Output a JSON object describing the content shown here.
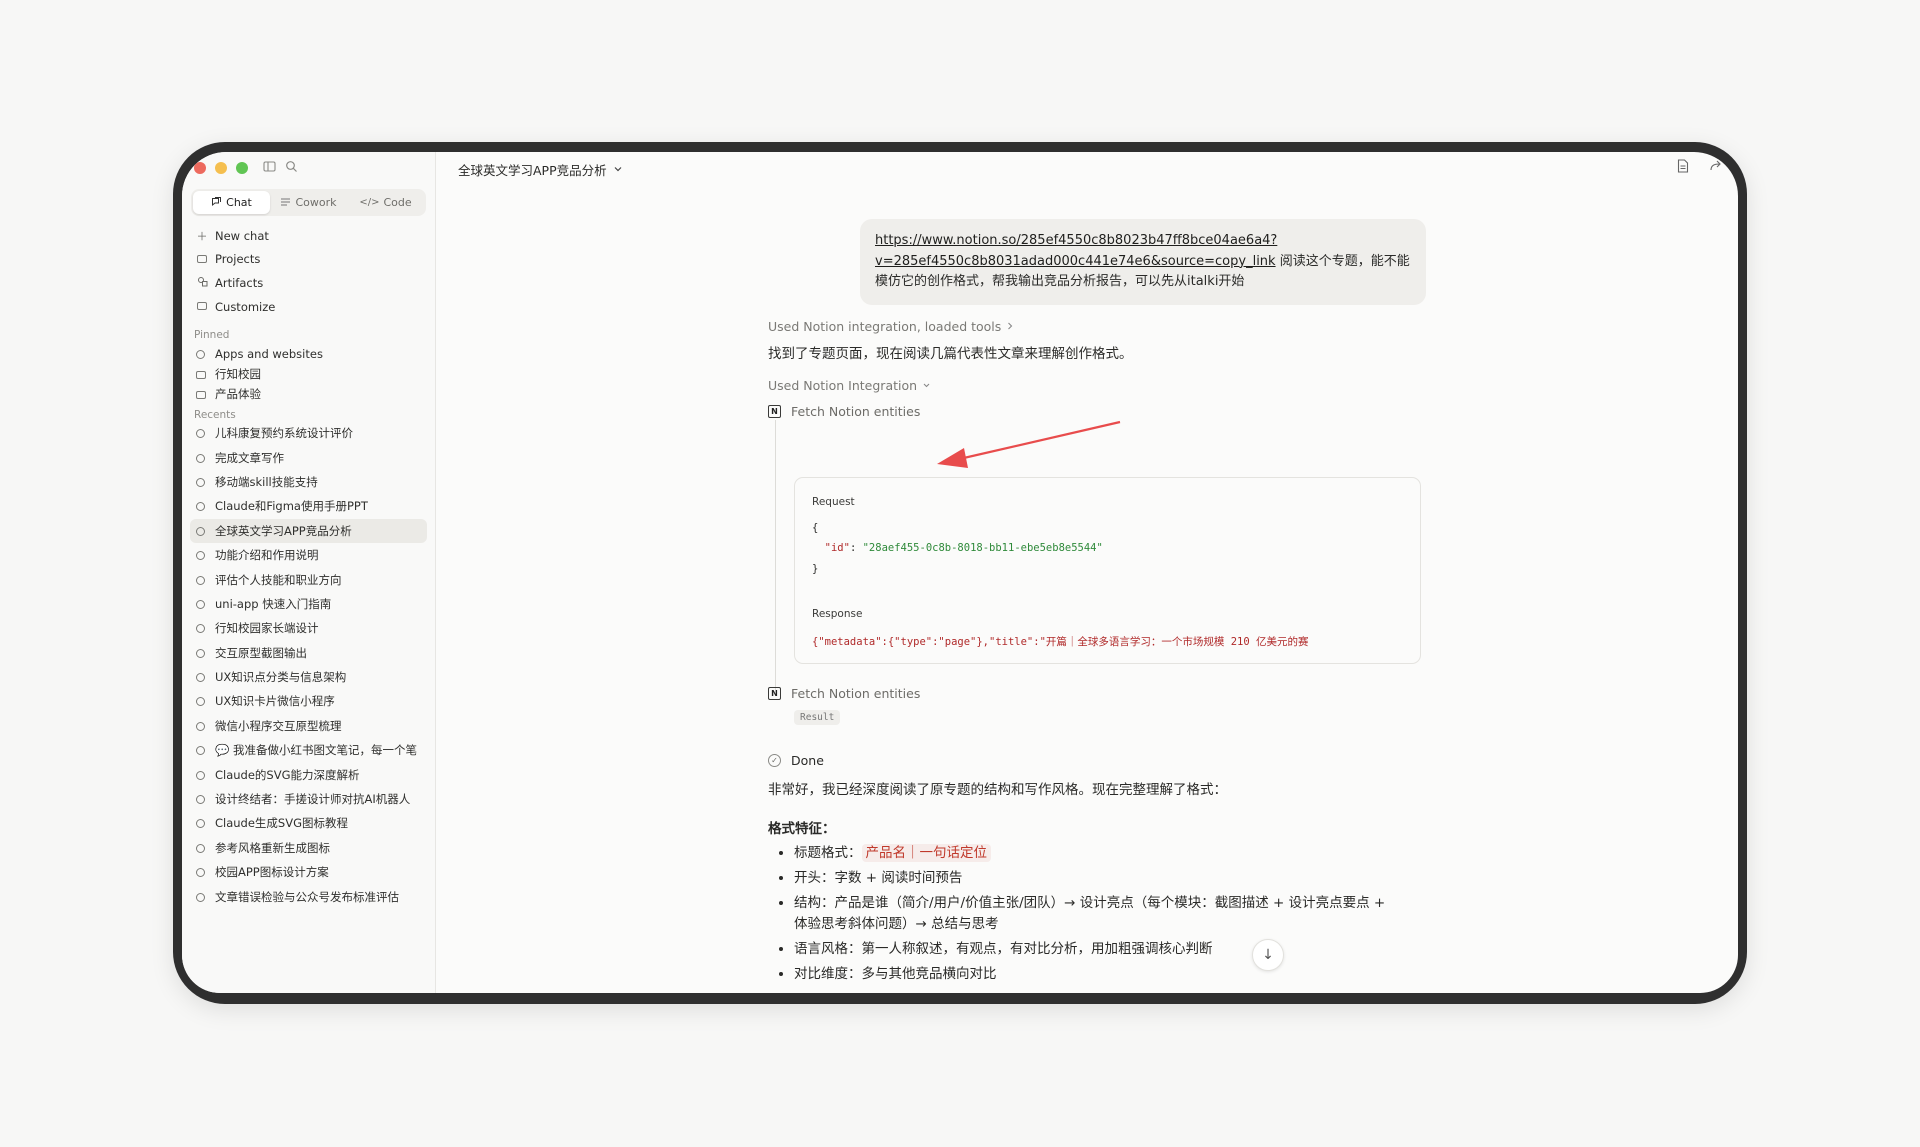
{
  "colors": {
    "red": "#ed6a5e",
    "yellow": "#f5bf4f",
    "green": "#61c554",
    "arrow": "#e84c4c"
  },
  "tabs": [
    {
      "label": "Chat",
      "icon": "chat-icon"
    },
    {
      "label": "Cowork",
      "icon": "cowork-icon"
    },
    {
      "label": "Code",
      "icon": "code-icon"
    }
  ],
  "nav": [
    {
      "label": "New chat",
      "icon": "plus-icon"
    },
    {
      "label": "Projects",
      "icon": "folder-icon"
    },
    {
      "label": "Artifacts",
      "icon": "artifacts-icon"
    },
    {
      "label": "Customize",
      "icon": "briefcase-icon"
    }
  ],
  "pinned_label": "Pinned",
  "pinned": [
    {
      "label": "Apps and websites",
      "icon": "chat-bubble-icon"
    },
    {
      "label": "行知校园",
      "icon": "project-icon"
    },
    {
      "label": "产品体验",
      "icon": "project-icon"
    }
  ],
  "recents_label": "Recents",
  "recents": [
    "儿科康复预约系统设计评价",
    "完成文章写作",
    "移动端skill技能支持",
    "Claude和Figma使用手册PPT",
    "全球英文学习APP竞品分析",
    "功能介绍和作用说明",
    "评估个人技能和职业方向",
    "uni-app 快速入门指南",
    "行知校园家长端设计",
    "交互原型截图输出",
    "UX知识点分类与信息架构",
    "UX知识卡片微信小程序",
    "微信小程序交互原型梳理",
    "💬 我准备做小红书图文笔记，每一个笔",
    "Claude的SVG能力深度解析",
    "设计终结者：手搓设计师对抗AI机器人",
    "Claude生成SVG图标教程",
    "参考风格重新生成图标",
    "校园APP图标设计方案",
    "文章错误检验与公众号发布标准评估"
  ],
  "header": {
    "title": "全球英文学习APP竞品分析"
  },
  "user_message": {
    "link": "https://www.notion.so/285ef4550c8b8023b47ff8bce04ae6a4?v=285ef4550c8b8031adad000c441e74e6&source=copy_link",
    "link_line1": "https://www.notion.so/285ef4550c8b8023b47ff8bce04ae6a4?",
    "link_line2": "v=285ef4550c8b8031adad000c441e74e6&source=copy_link",
    "text": " 阅读这个专题，能不能模仿它的创作格式，帮我输出竞品分析报告，可以先从italki开始"
  },
  "assistant": {
    "tool_used_1": "Used Notion integration, loaded tools",
    "found_text": "找到了专题页面，现在阅读几篇代表性文章来理解创作格式。",
    "tool_used_2": "Used Notion Integration",
    "fetch_label": "Fetch Notion entities",
    "request_label": "Request",
    "request_id_key": "\"id\"",
    "request_id_value": "\"28aef455-0c8b-8018-bb11-ebe5eb8e5544\"",
    "response_label": "Response",
    "response_line": "{\"metadata\":{\"type\":\"page\"},\"title\":\"开篇｜全球多语言学习：一个市场规模 210 亿美元的赛",
    "result_tag": "Result",
    "done_label": "Done",
    "summary": "非常好，我已经深度阅读了原专题的结构和写作风格。现在完整理解了格式：",
    "format_heading": "格式特征：",
    "bullet1_prefix": "标题格式：",
    "bullet1_pill": "产品名｜一句话定位",
    "bullet2": "开头：字数 + 阅读时间预告",
    "bullet3": "结构：产品是谁（简介/用户/价值主张/团队）→ 设计亮点（每个模块：截图描述 + 设计亮点要点 + 体验思考斜体问题）→ 总结与思考",
    "bullet4": "语言风格：第一人称叙述，有观点，有对比分析，用加粗强调核心判断",
    "bullet5": "对比维度：多与其他竞品横向对比"
  }
}
